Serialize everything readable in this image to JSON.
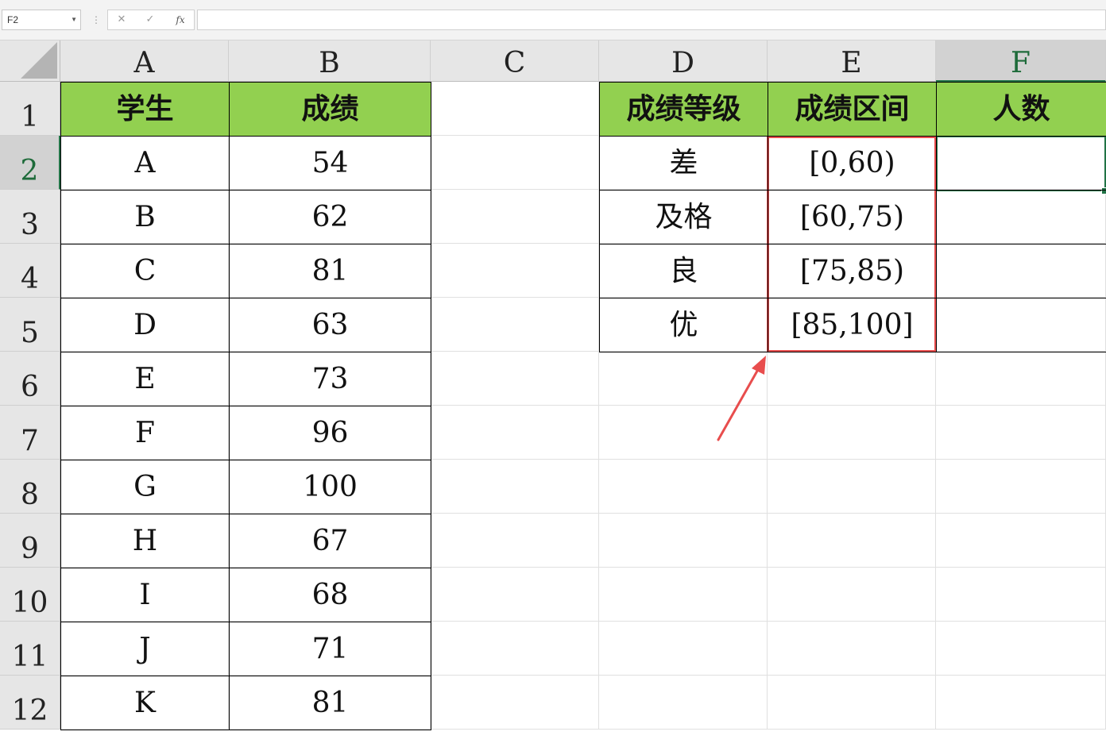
{
  "name_box": {
    "value": "F2"
  },
  "formula_bar": {
    "cancel": "✕",
    "confirm": "✓",
    "fx": "fx",
    "content": ""
  },
  "columns": [
    "A",
    "B",
    "C",
    "D",
    "E",
    "F"
  ],
  "rows": [
    "1",
    "2",
    "3",
    "4",
    "5",
    "6",
    "7",
    "8",
    "9",
    "10",
    "11",
    "12"
  ],
  "active_cell": "F2",
  "table_left": {
    "headers": [
      "学生",
      "成绩"
    ],
    "rows": [
      [
        "A",
        "54"
      ],
      [
        "B",
        "62"
      ],
      [
        "C",
        "81"
      ],
      [
        "D",
        "63"
      ],
      [
        "E",
        "73"
      ],
      [
        "F",
        "96"
      ],
      [
        "G",
        "100"
      ],
      [
        "H",
        "67"
      ],
      [
        "I",
        "68"
      ],
      [
        "J",
        "71"
      ],
      [
        "K",
        "81"
      ]
    ]
  },
  "table_right": {
    "headers": [
      "成绩等级",
      "成绩区间",
      "人数"
    ],
    "rows": [
      [
        "差",
        "[0,60)",
        ""
      ],
      [
        "及格",
        "[60,75)",
        ""
      ],
      [
        "良",
        "[75,85)",
        ""
      ],
      [
        "优",
        "[85,100]",
        ""
      ]
    ]
  },
  "colors": {
    "header_fill": "#92d050",
    "highlight_box": "#e84d4d",
    "selection": "#217346"
  }
}
